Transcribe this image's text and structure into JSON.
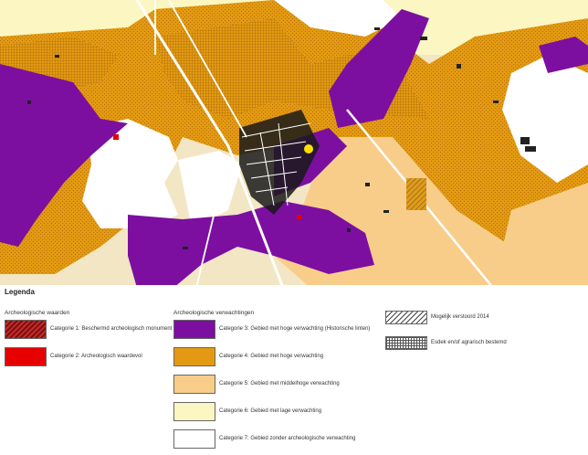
{
  "legend": {
    "title": "Legenda",
    "waarden_heading": "Archeologische waarden",
    "verwachtingen_heading": "Archeologische verwachtingen",
    "items": {
      "cat1": {
        "label": "Categorie 1: Beschermd archeologisch monument",
        "color": "#a01c1c"
      },
      "cat2": {
        "label": "Categorie 2: Archeologisch waardevol",
        "color": "#e60000"
      },
      "cat3": {
        "label": "Categorie 3: Gebied met hoge verwachting (Historische linten)",
        "color": "#7c0fa0"
      },
      "cat4": {
        "label": "Categorie 4: Gebied met hoge verwachting",
        "color": "#e39a12"
      },
      "cat5": {
        "label": "Categorie 5: Gebied met middelhoge verwachting",
        "color": "#f8cd8a"
      },
      "cat6": {
        "label": "Categorie 6: Gebied met lage verwachting",
        "color": "#fbf6c2"
      },
      "cat7": {
        "label": "Categorie 7: Gebied zonder archeologische verwachting",
        "color": "#ffffff"
      },
      "verstoord": {
        "label": "Mogelijk verstoord 2014"
      },
      "agrarisch": {
        "label": "Esdek en/of agrarisch bestemd"
      }
    }
  }
}
